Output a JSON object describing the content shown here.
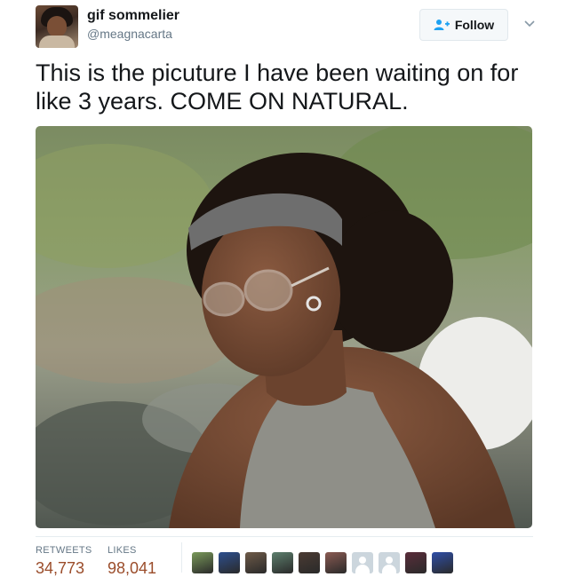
{
  "user": {
    "display_name": "gif sommelier",
    "handle": "@meagnacarta"
  },
  "follow_button": {
    "label": "Follow"
  },
  "tweet": {
    "text": "This is the picuture I have been waiting on for like 3 years. COME ON NATURAL."
  },
  "stats": {
    "retweets_label": "RETWEETS",
    "retweets_count": "34,773",
    "likes_label": "LIKES",
    "likes_count": "98,041"
  },
  "likers": [
    {
      "color": "#7a9a5a"
    },
    {
      "color": "#2d4f8f"
    },
    {
      "color": "#6e5a48"
    },
    {
      "color": "#5d7f6d"
    },
    {
      "color": "#4b3b33"
    },
    {
      "color": "#8a5a52"
    },
    {
      "placeholder": true
    },
    {
      "placeholder": true
    },
    {
      "color": "#5a2d3a"
    },
    {
      "color": "#2f4fa8"
    }
  ],
  "colors": {
    "accent_count": "#9b4d2b",
    "secondary_text": "#657786",
    "follow_icon": "#1da1f2"
  }
}
